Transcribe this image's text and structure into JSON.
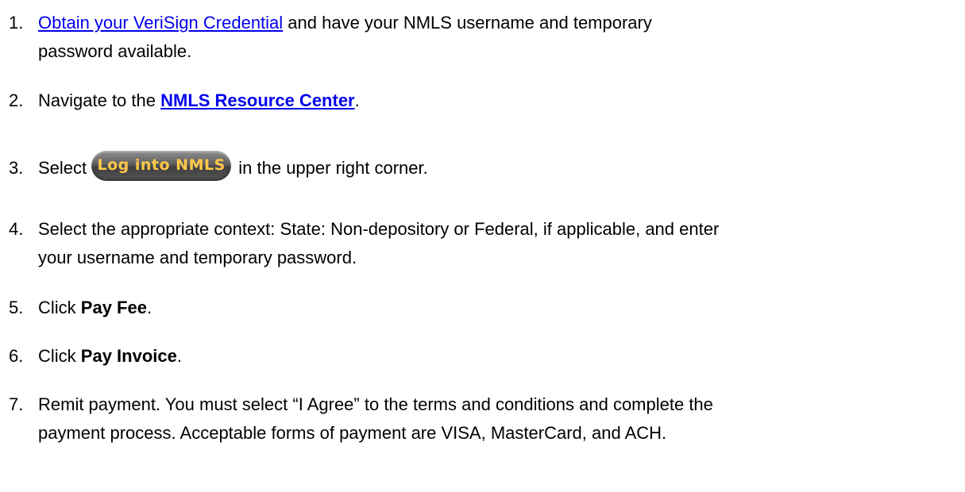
{
  "steps": [
    {
      "number": "1.",
      "link_text": "Obtain your VeriSign Credential",
      "line1_rest": " and have your NMLS username and temporary",
      "line2": "password available."
    },
    {
      "number": "2.",
      "prefix": "Navigate to the ",
      "link_text": "NMLS Resource Center",
      "suffix": "."
    },
    {
      "number": "3.",
      "prefix": "Select",
      "button_label": "Log into NMLS",
      "suffix": " in the upper right corner."
    },
    {
      "number": "4.",
      "line1": "Select the appropriate context: State: Non-depository or Federal, if applicable, and enter",
      "line2": "your username and temporary password."
    },
    {
      "number": "5.",
      "prefix": "Click ",
      "bold": "Pay Fee",
      "suffix": "."
    },
    {
      "number": "6.",
      "prefix": "Click ",
      "bold": "Pay Invoice",
      "suffix": "."
    },
    {
      "number": "7.",
      "line1": "Remit payment.  You must select “I Agree” to the terms and conditions and complete the",
      "line2": "payment process.  Acceptable forms of payment are VISA, MasterCard, and ACH."
    }
  ]
}
